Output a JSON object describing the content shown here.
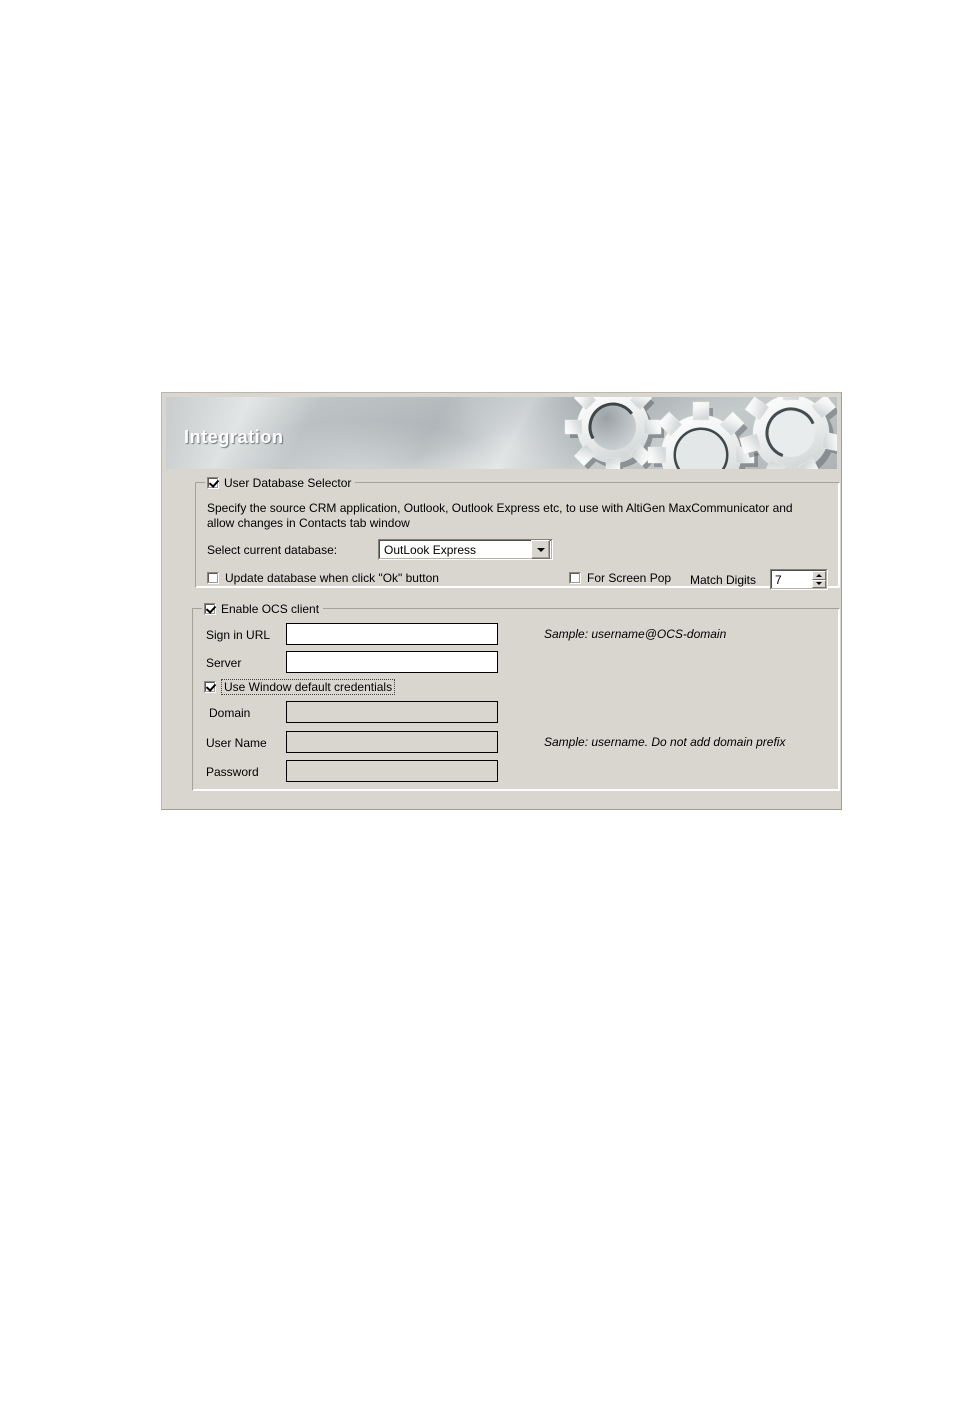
{
  "window": {
    "banner_title": "Integration",
    "gear_icon_names": [
      "gear-icon-left",
      "gear-icon-center",
      "gear-icon-right"
    ]
  },
  "user_database_selector": {
    "legend": "User Database Selector",
    "legend_checked": true,
    "description": "Specify the source CRM application, Outlook, Outlook Express etc, to use with AltiGen MaxCommunicator and allow changes in Contacts tab window",
    "select_label": "Select current database:",
    "select_value": "OutLook Express",
    "select_options": [
      "OutLook Express"
    ],
    "update_db_label": "Update database when click \"Ok\" button",
    "update_db_checked": false,
    "screen_pop_label": "For Screen Pop",
    "screen_pop_checked": false,
    "match_digits_label": "Match Digits",
    "match_digits_value": "7"
  },
  "ocs_client": {
    "legend": "Enable OCS client",
    "legend_checked": true,
    "sign_in_url_label": "Sign in URL",
    "sign_in_url_value": "",
    "sign_in_url_sample": "Sample: username@OCS-domain",
    "server_label": "Server",
    "server_value": "",
    "use_window_credentials_label": "Use Window default credentials",
    "use_window_credentials_checked": true,
    "domain_label": "Domain",
    "domain_value": "",
    "user_name_label": "User Name",
    "user_name_value": "",
    "user_name_sample": "Sample: username. Do not add domain prefix",
    "password_label": "Password",
    "password_value": ""
  },
  "colors": {
    "dialog_background": "#d9d6d0",
    "banner_text": "#ffffff",
    "field_border": "#000000",
    "text": "#000000"
  }
}
